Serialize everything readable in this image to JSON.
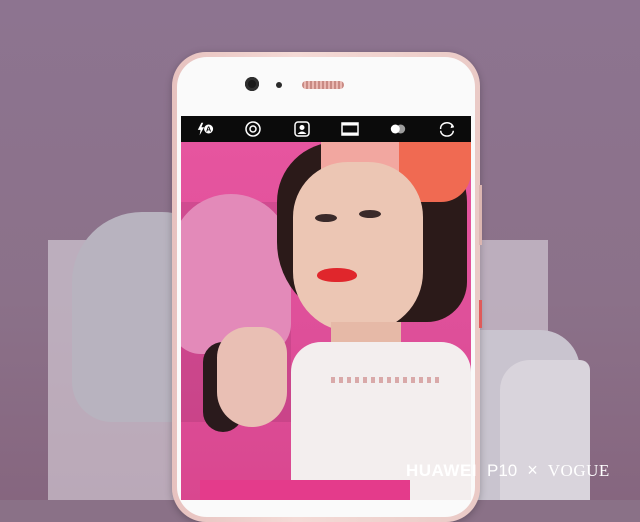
{
  "brand": {
    "maker": "HUAWEI",
    "model": "P10",
    "separator": "×",
    "partner": "VOGUE"
  },
  "camera_toolbar": {
    "items": [
      {
        "icon": "flash-auto-icon",
        "glyph": "⚡A"
      },
      {
        "icon": "aperture-icon",
        "glyph": "◎"
      },
      {
        "icon": "portrait-mode-icon",
        "glyph": "👤"
      },
      {
        "icon": "filmstrip-icon",
        "glyph": "▤"
      },
      {
        "icon": "filters-icon",
        "glyph": "●●"
      },
      {
        "icon": "switch-camera-icon",
        "glyph": "⟲"
      }
    ]
  },
  "colors": {
    "background": "#8a7187",
    "phone_body": "#f0d2cd",
    "viewfinder_bg": "#e2559a",
    "toolbar_bg": "#0b0b0b",
    "brand_text": "#ffffff"
  }
}
